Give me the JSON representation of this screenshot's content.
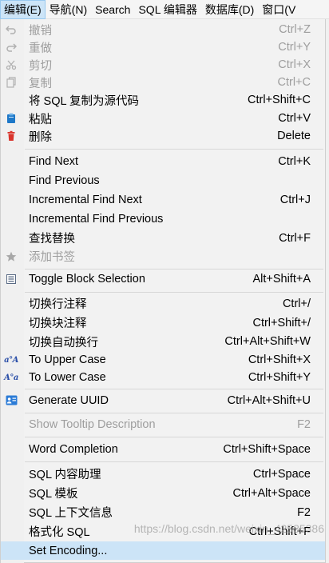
{
  "menubar": {
    "edit": "编辑(E)",
    "navigate": "导航(N)",
    "search": "Search",
    "sql_editor": "SQL 编辑器",
    "database": "数据库(D)",
    "window": "窗口(V"
  },
  "menu": {
    "undo": {
      "label": "撤销",
      "shortcut": "Ctrl+Z"
    },
    "redo": {
      "label": "重做",
      "shortcut": "Ctrl+Y"
    },
    "cut": {
      "label": "剪切",
      "shortcut": "Ctrl+X"
    },
    "copy": {
      "label": "复制",
      "shortcut": "Ctrl+C"
    },
    "copy_sql_source": {
      "label": "将 SQL 复制为源代码",
      "shortcut": "Ctrl+Shift+C"
    },
    "paste": {
      "label": "粘贴",
      "shortcut": "Ctrl+V"
    },
    "delete": {
      "label": "删除",
      "shortcut": "Delete"
    },
    "find_next": {
      "label": "Find Next",
      "shortcut": "Ctrl+K"
    },
    "find_previous": {
      "label": "Find Previous",
      "shortcut": ""
    },
    "incremental_find_next": {
      "label": "Incremental Find Next",
      "shortcut": "Ctrl+J"
    },
    "incremental_find_previous": {
      "label": "Incremental Find Previous",
      "shortcut": ""
    },
    "find_replace": {
      "label": "查找替换",
      "shortcut": "Ctrl+F"
    },
    "add_bookmark": {
      "label": "添加书签",
      "shortcut": ""
    },
    "toggle_block_selection": {
      "label": "Toggle Block Selection",
      "shortcut": "Alt+Shift+A"
    },
    "toggle_line_comment": {
      "label": "切换行注释",
      "shortcut": "Ctrl+/"
    },
    "toggle_block_comment": {
      "label": "切换块注释",
      "shortcut": "Ctrl+Shift+/"
    },
    "toggle_word_wrap": {
      "label": "切换自动换行",
      "shortcut": "Ctrl+Alt+Shift+W"
    },
    "to_upper_case": {
      "label": "To Upper Case",
      "shortcut": "Ctrl+Shift+X"
    },
    "to_lower_case": {
      "label": "To Lower Case",
      "shortcut": "Ctrl+Shift+Y"
    },
    "generate_uuid": {
      "label": "Generate UUID",
      "shortcut": "Ctrl+Alt+Shift+U"
    },
    "show_tooltip": {
      "label": "Show Tooltip Description",
      "shortcut": "F2"
    },
    "word_completion": {
      "label": "Word Completion",
      "shortcut": "Ctrl+Shift+Space"
    },
    "sql_content_assist": {
      "label": "SQL 内容助理",
      "shortcut": "Ctrl+Space"
    },
    "sql_template": {
      "label": "SQL 模板",
      "shortcut": "Ctrl+Alt+Space"
    },
    "sql_context_info": {
      "label": "SQL 上下文信息",
      "shortcut": "F2"
    },
    "format_sql": {
      "label": "格式化 SQL",
      "shortcut": "Ctrl+Shift+F"
    },
    "set_encoding": {
      "label": "Set Encoding...",
      "shortcut": ""
    }
  },
  "icons": {
    "undo": "undo-icon",
    "redo": "redo-icon",
    "cut": "scissors-icon",
    "copy": "copy-icon",
    "paste": "clipboard-icon",
    "delete": "trash-icon",
    "bookmark": "star-icon",
    "block_selection": "block-selection-icon",
    "upper_case": "upper-case-icon",
    "lower_case": "lower-case-icon",
    "uuid": "id-card-icon"
  },
  "icon_text": {
    "upper": "a°A",
    "lower": "A°a"
  },
  "colors": {
    "highlight": "#cce4f7",
    "disabled_text": "#9e9e9e",
    "paste_icon": "#1e78c8",
    "delete_icon": "#d9342b"
  },
  "watermark": "https://blog.csdn.net/weixin_42585386"
}
